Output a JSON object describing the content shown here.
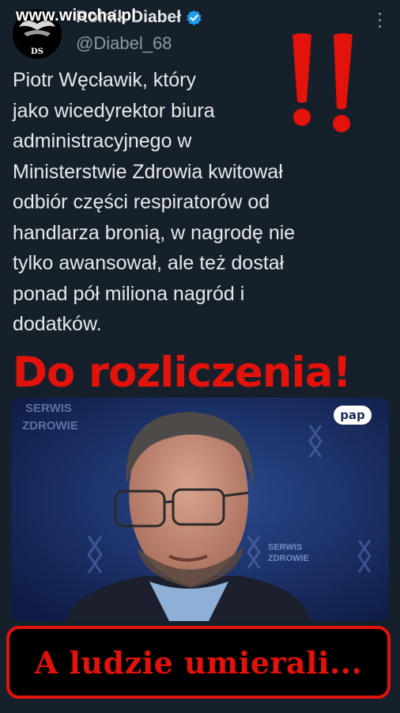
{
  "watermark": "www.wiocha.pl",
  "author": {
    "display_name": "Rolnik Diabeł",
    "handle": "@Diabel_68",
    "avatar_monogram": "DS"
  },
  "tweet": {
    "text": "Piotr Węcławik, który\njako wicedyrektor biura\nadministracyjnego w\nMinisterstwie Zdrowia kwitował\nodbiór części respiratorów od\nhandlarza bronią, w nagrodę nie\ntylko awansował, ale też dostał\nponad pół miliona nagród i\ndodatków."
  },
  "headline": "Do rozliczenia!",
  "photo": {
    "backdrop_text_1": "SERWIS",
    "backdrop_text_2": "ZDROWIE",
    "backdrop_text_3": "SERWIS",
    "backdrop_text_4": "ZDROWIE",
    "agency_badge": "pap"
  },
  "bottom_banner": "A ludzie umierali...",
  "colors": {
    "background": "#15202b",
    "alert_red": "#e3120b",
    "verified_blue": "#1d9bf0"
  },
  "icons": [
    "verified-badge-icon",
    "more-options-icon",
    "exclamation-marks-icon"
  ]
}
